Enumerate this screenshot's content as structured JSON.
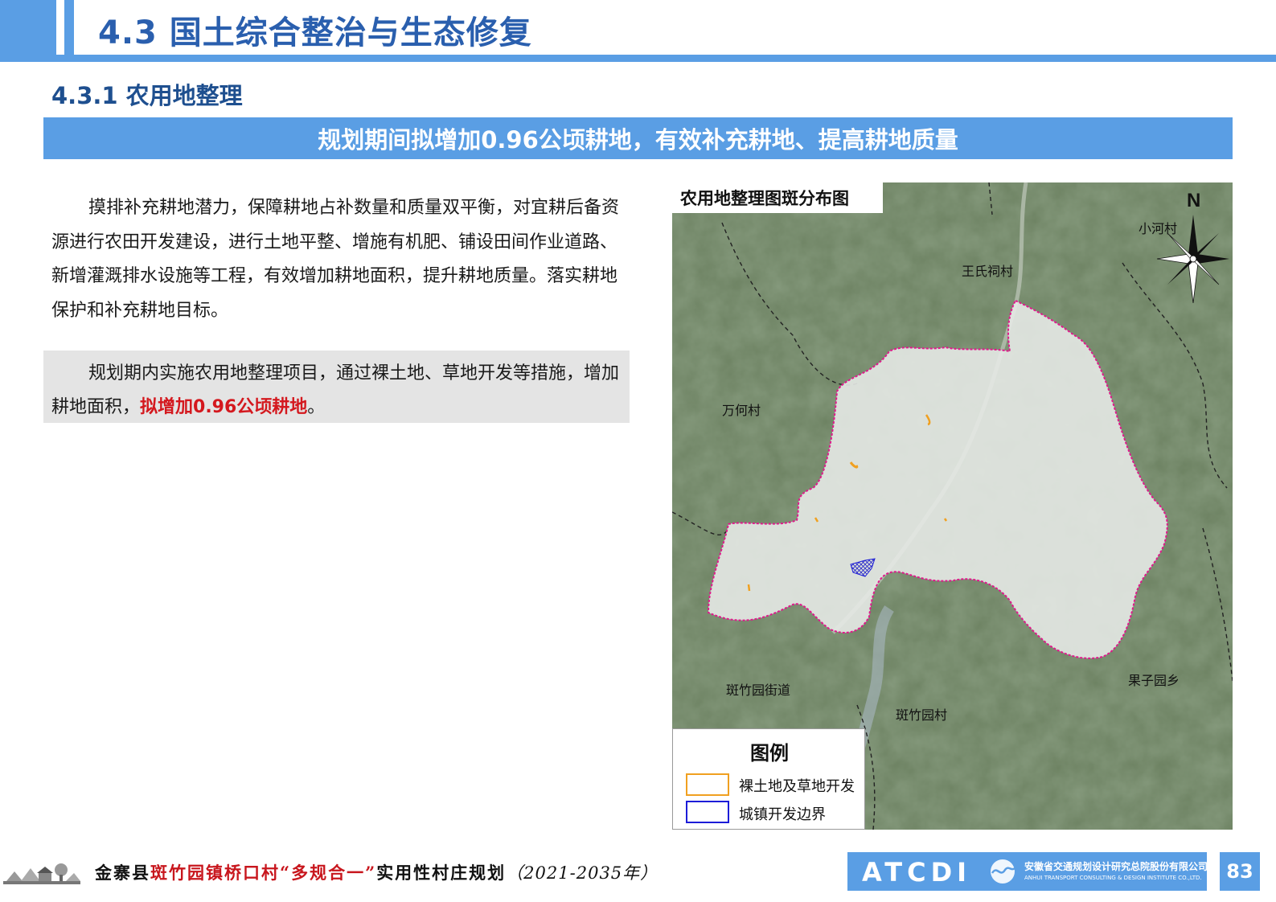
{
  "header": {
    "title": "4.3 国土综合整治与生态修复"
  },
  "section": {
    "title": "4.3.1 农用地整理"
  },
  "banner": {
    "text": "规划期间拟增加0.96公顷耕地，有效补充耕地、提高耕地质量"
  },
  "body": {
    "paragraph1": "摸排补充耕地潜力，保障耕地占补数量和质量双平衡，对宜耕后备资源进行农田开发建设，进行土地平整、增施有机肥、铺设田间作业道路、新增灌溉排水设施等工程，有效增加耕地面积，提升耕地质量。落实耕地保护和补充耕地目标。",
    "paragraph2_prefix": "规划期内实施农用地整理项目，通过裸土地、草地开发等措施，增加耕地面积，",
    "paragraph2_highlight": "拟增加0.96公顷耕地",
    "paragraph2_suffix": "。"
  },
  "map": {
    "title": "农用地整理图斑分布图",
    "north_label": "N",
    "places": {
      "xiaohe": "小河村",
      "wangshici": "王氏祠村",
      "wanhe": "万何村",
      "banzhuyuan_jiedao": "斑竹园街道",
      "banzhuyuan_cun": "斑竹园村",
      "guoziyuan": "果子园乡"
    },
    "legend": {
      "title": "图例",
      "items": [
        {
          "label": "裸土地及草地开发",
          "color": "#f0a020"
        },
        {
          "label": "城镇开发边界",
          "color": "#1c1cd8"
        }
      ]
    },
    "colors": {
      "boundary": "#e0198c",
      "terrain": "#6c8161",
      "village_area": "#e6e9e6"
    }
  },
  "footer": {
    "county": "金寨县",
    "project": "斑竹园镇桥口村",
    "quote_open": "“",
    "plan_name": "多规合一",
    "quote_close": "”",
    "plan_type": "实用性村庄规划",
    "years": "（2021-2035年）",
    "logo_text": "ATCDI",
    "logo_cn": "安徽省交通规划设计研究总院股份有限公司",
    "logo_en": "ANHUI TRANSPORT CONSULTING & DESIGN INSTITUTE CO.,LTD.",
    "page_number": "83"
  }
}
